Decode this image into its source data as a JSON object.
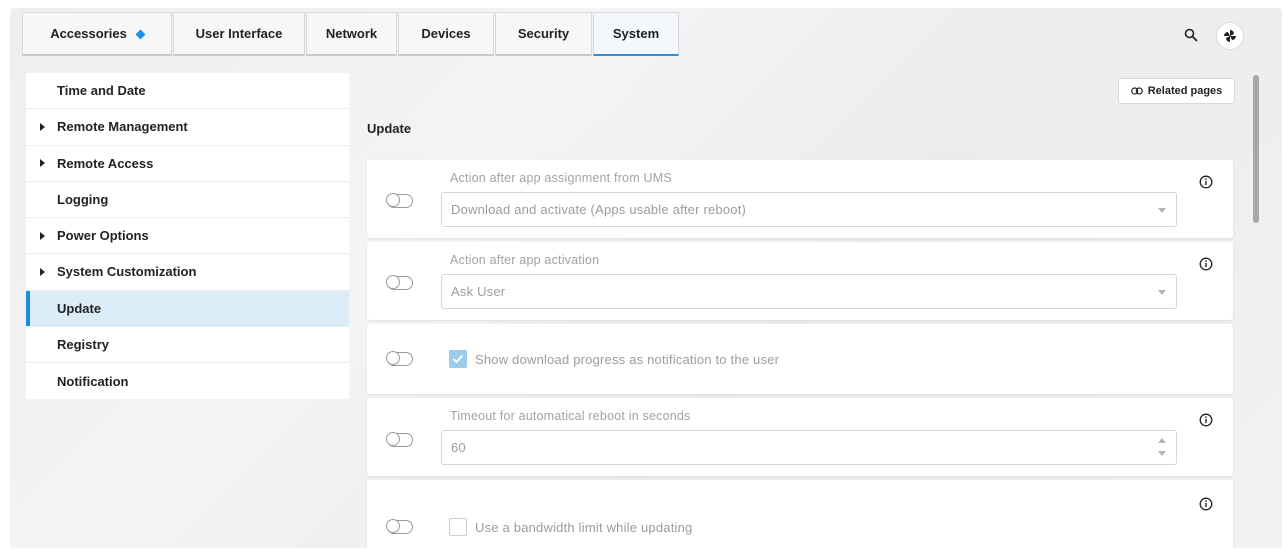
{
  "tabs": [
    {
      "label": "Accessories",
      "has_badge": true
    },
    {
      "label": "User Interface"
    },
    {
      "label": "Network"
    },
    {
      "label": "Devices"
    },
    {
      "label": "Security"
    },
    {
      "label": "System",
      "active": true
    }
  ],
  "header_icons": [
    "search-icon",
    "pinwheel-icon"
  ],
  "sidebar": {
    "items": [
      {
        "label": "Time and Date",
        "expandable": false
      },
      {
        "label": "Remote Management",
        "expandable": true
      },
      {
        "label": "Remote Access",
        "expandable": true
      },
      {
        "label": "Logging",
        "expandable": false
      },
      {
        "label": "Power Options",
        "expandable": true
      },
      {
        "label": "System Customization",
        "expandable": true
      },
      {
        "label": "Update",
        "expandable": false,
        "selected": true
      },
      {
        "label": "Registry",
        "expandable": false
      },
      {
        "label": "Notification",
        "expandable": false
      }
    ]
  },
  "main": {
    "related_pages_label": "Related pages",
    "section_title": "Update",
    "settings": {
      "app_assignment": {
        "label": "Action after app assignment from UMS",
        "value": "Download and activate (Apps usable after reboot)",
        "enabled": false
      },
      "app_activation": {
        "label": "Action after app activation",
        "value": "Ask User",
        "enabled": false
      },
      "download_progress": {
        "label": "Show download progress as notification to the user",
        "checked": true,
        "enabled": false
      },
      "reboot_timeout": {
        "label": "Timeout for automatical reboot in seconds",
        "value": "60",
        "enabled": false
      },
      "bandwidth_limit": {
        "label": "Use a bandwidth limit while updating",
        "checked": false,
        "enabled": false
      }
    }
  },
  "colors": {
    "accent": "#1b8ddb",
    "selected_bg": "#d9ecf8",
    "disabled_text": "#9c9c9f"
  }
}
